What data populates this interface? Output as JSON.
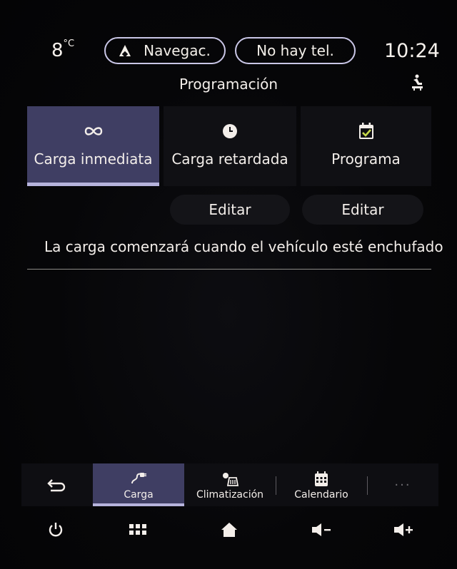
{
  "status_bar": {
    "temperature": "8",
    "temperature_unit": "°C",
    "navigation_label": "Navegac.",
    "phone_label": "No hay tel.",
    "time": "10:24"
  },
  "page": {
    "title": "Programación"
  },
  "modes": [
    {
      "label": "Carga inmediata",
      "icon": "infinity-icon",
      "selected": true
    },
    {
      "label": "Carga retardada",
      "icon": "clock-icon",
      "selected": false
    },
    {
      "label": "Programa",
      "icon": "calendar-check-icon",
      "selected": false
    }
  ],
  "edit_buttons": [
    "Editar",
    "Editar"
  ],
  "info_message": "La carga comenzará cuando el vehículo esté enchufado",
  "tabs": [
    {
      "label": "Carga",
      "icon": "charging-plug-icon",
      "selected": true
    },
    {
      "label": "Climatización",
      "icon": "climate-icon",
      "selected": false
    },
    {
      "label": "Calendario",
      "icon": "calendar-icon",
      "selected": false
    }
  ],
  "more_label": "···",
  "colors": {
    "accent": "#3f3e63",
    "accent_border": "#b6b3dc",
    "background": "#050507",
    "text": "#f3eeea"
  }
}
